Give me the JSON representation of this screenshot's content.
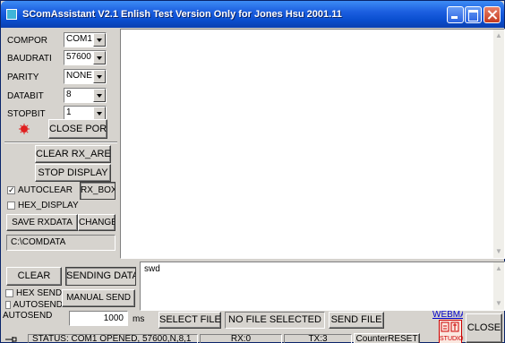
{
  "window": {
    "title": "SComAssistant V2.1   Enlish Test Version  Only for Jones Hsu 2001.11"
  },
  "settings": {
    "comport_label": "COMPOR",
    "comport_value": "COM1",
    "baud_label": "BAUDRATI",
    "baud_value": "57600",
    "parity_label": "PARITY",
    "parity_value": "NONE",
    "databit_label": "DATABIT",
    "databit_value": "8",
    "stopbit_label": "STOPBIT",
    "stopbit_value": "1"
  },
  "buttons": {
    "close_port": "CLOSE PORT",
    "clear_rx_area": "CLEAR RX_AREA",
    "stop_display": "STOP DISPLAY",
    "rx_box": "RX_BOX",
    "save_rxdata": "SAVE RXDATA",
    "change": "CHANGE",
    "clear": "CLEAR",
    "sending_data": "SENDING DATA",
    "manual_send": "MANUAL SEND",
    "select_file": "SELECT FILE",
    "send_file": "SEND FILE",
    "close": "CLOSE",
    "counter_reset": "CounterRESET"
  },
  "options": {
    "autoclear": {
      "label": "AUTOCLEAR",
      "checked": true
    },
    "hex_display": {
      "label": "HEX_DISPLAY",
      "checked": false
    },
    "hex_send": {
      "label": "HEX SEND",
      "checked": false
    },
    "autosend_chk": {
      "label": "AUTOSEND",
      "checked": false
    }
  },
  "save_path": "C:\\COMDATA",
  "send": {
    "text": "swd",
    "autosend_label": "AUTOSEND",
    "period_value": "1000",
    "period_unit": "ms",
    "file_status": "NO FILE SELECTED"
  },
  "links": {
    "webmail": "WEBMAIL",
    "studio_badge": "STUDIO"
  },
  "status": {
    "status_text": "STATUS: COM1 OPENED, 57600,N,8,1",
    "rx_count": "RX:0",
    "tx_count": "TX:3"
  },
  "colors": {
    "port_indicator": "#e02020",
    "title_blue": "#0a4fd0",
    "face": "#d6d3ce"
  }
}
